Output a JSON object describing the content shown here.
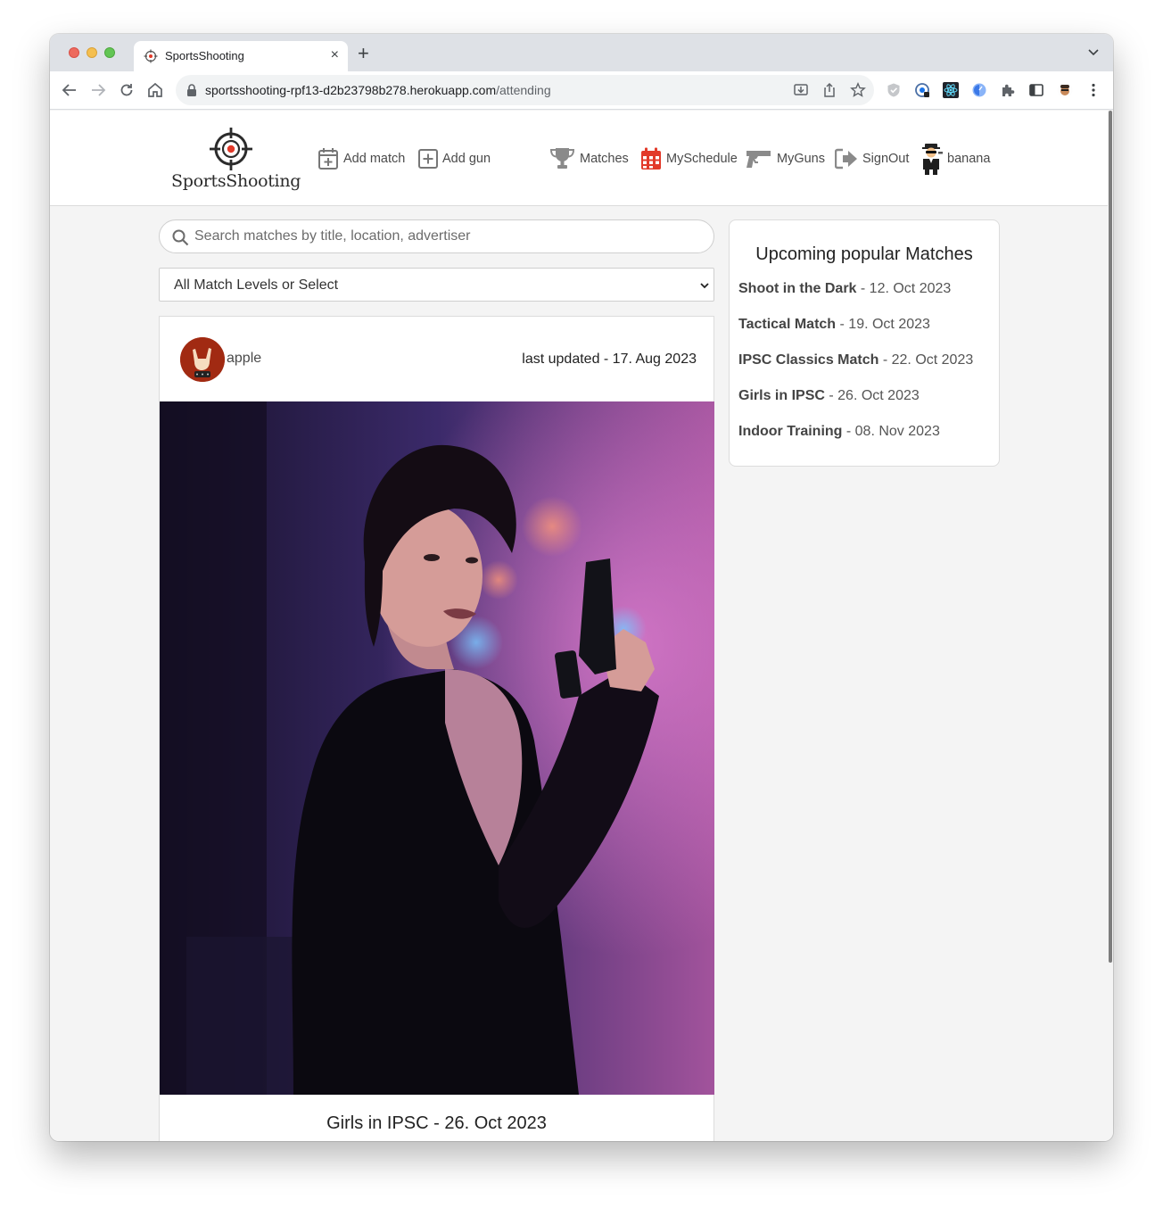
{
  "browser": {
    "tab_title": "SportsShooting",
    "new_tab": "+",
    "tab_close": "×",
    "url_domain": "sportsshooting-rpf13-d2b23798b278.herokuapp.com",
    "url_path": "/attending"
  },
  "site": {
    "brand": "SportsShooting",
    "nav": {
      "add_match": "Add match",
      "add_gun": "Add gun",
      "matches": "Matches",
      "my_schedule": "MySchedule",
      "my_guns": "MyGuns",
      "sign_out": "SignOut",
      "username": "banana"
    },
    "accent_color": "#e23a2a"
  },
  "search": {
    "placeholder": "Search matches by title, location, advertiser",
    "value": ""
  },
  "level_filter": {
    "selected": "All Match Levels or Select"
  },
  "post": {
    "author": "apple",
    "updated": "last updated - 17. Aug 2023",
    "title": "Girls in IPSC - 26. Oct 2023"
  },
  "sidebar": {
    "title": "Upcoming popular Matches",
    "items": [
      {
        "name": "Shoot in the Dark",
        "date": " - 12. Oct 2023"
      },
      {
        "name": "Tactical Match",
        "date": " - 19. Oct 2023"
      },
      {
        "name": "IPSC Classics Match",
        "date": " - 22. Oct 2023"
      },
      {
        "name": "Girls in IPSC",
        "date": " - 26. Oct 2023"
      },
      {
        "name": "Indoor Training",
        "date": " - 08. Nov 2023"
      }
    ]
  }
}
